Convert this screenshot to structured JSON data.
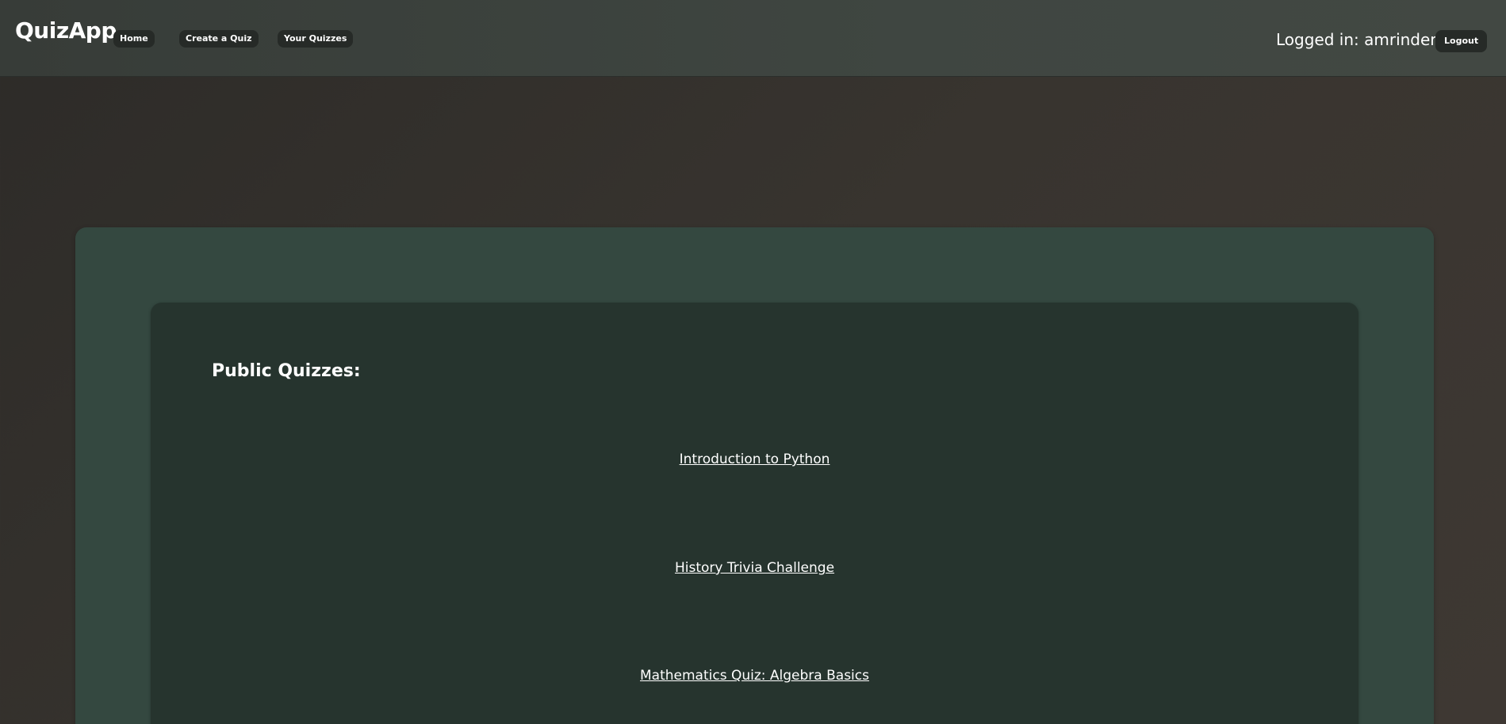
{
  "navbar": {
    "brand": "QuizApp",
    "links": [
      {
        "label": "Home"
      },
      {
        "label": "Create a Quiz"
      },
      {
        "label": "Your Quizzes"
      }
    ],
    "logged_in_text": "Logged in: amrinder",
    "logout_label": "Logout"
  },
  "main": {
    "section_title": "Public Quizzes:",
    "quizzes": [
      {
        "title": "Introduction to Python"
      },
      {
        "title": "History Trivia Challenge"
      },
      {
        "title": "Mathematics Quiz: Algebra Basics"
      }
    ]
  },
  "colors": {
    "navbar_bg": "#3f4641",
    "page_bg": "#38342f",
    "outer_panel_bg": "#344840",
    "inner_panel_bg": "#26342e",
    "pill_bg": "#262a27",
    "text": "#ffffff"
  }
}
